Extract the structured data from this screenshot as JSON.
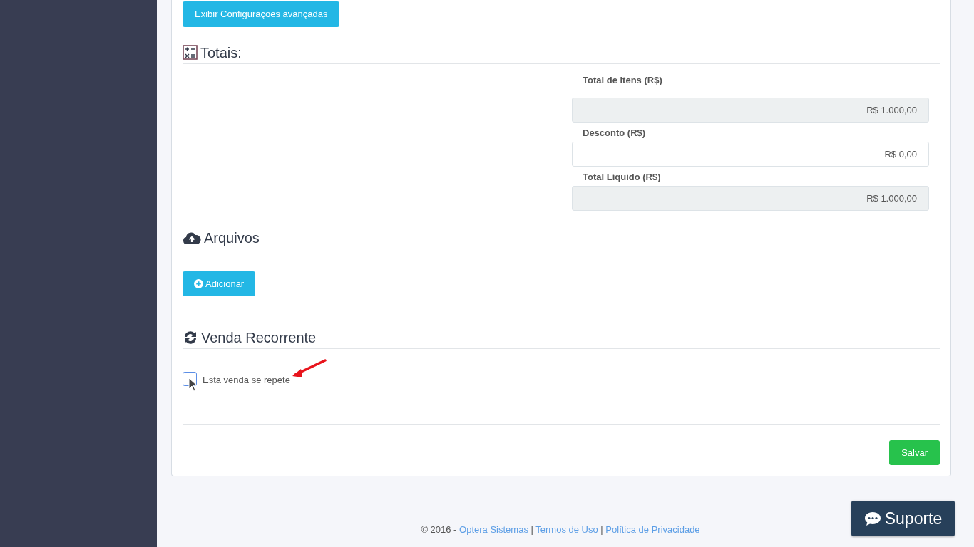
{
  "advanced_button": "Exibir Configurações avançadas",
  "totals": {
    "title": "Totais:",
    "fields": [
      {
        "label": "Total de Itens (R$)",
        "value": "R$ 1.000,00",
        "readonly": true
      },
      {
        "label": "Desconto (R$)",
        "value": "R$ 0,00",
        "readonly": false
      },
      {
        "label": "Total Líquido (R$)",
        "value": "R$ 1.000,00",
        "readonly": true
      }
    ]
  },
  "files": {
    "title": "Arquivos",
    "add_button": "Adicionar"
  },
  "recurring": {
    "title": "Venda Recorrente",
    "checkbox": {
      "label": "Esta venda se repete",
      "checked": false
    }
  },
  "save_button": "Salvar",
  "footer": {
    "prefix": "© 2016 -",
    "links": [
      "Optera Sistemas",
      "Termos de Uso",
      "Política de Privacidade"
    ],
    "separators": [
      "|",
      "|"
    ]
  },
  "support_button": "Suporte"
}
